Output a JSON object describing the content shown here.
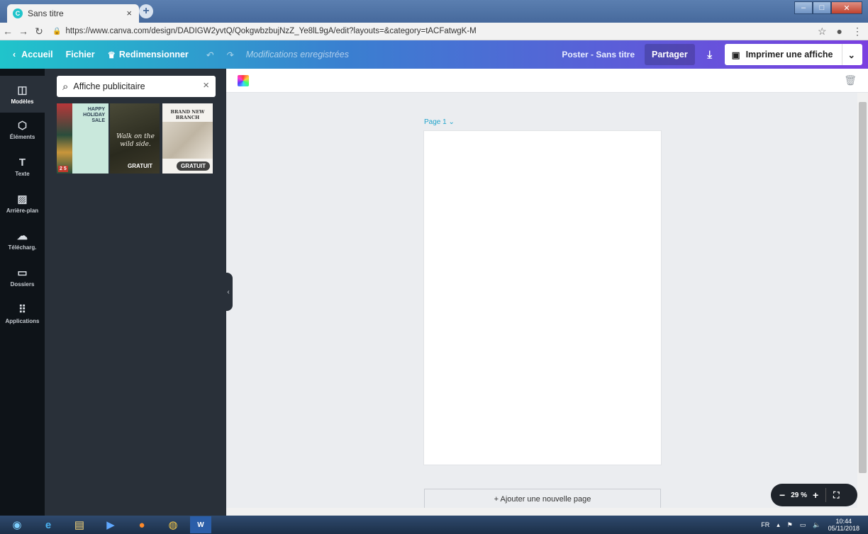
{
  "browser": {
    "tab_title": "Sans titre",
    "tab_favicon": "C",
    "url": "https://www.canva.com/design/DADIGW2yvtQ/QokgwbzbujNzZ_Ye8lL9gA/edit?layouts=&category=tACFatwgK-M"
  },
  "header": {
    "home": "Accueil",
    "file": "Fichier",
    "resize": "Redimensionner",
    "saved_status": "Modifications enregistrées",
    "design_title": "Poster - Sans titre",
    "share": "Partager",
    "print": "Imprimer une affiche"
  },
  "rail": {
    "items": [
      {
        "label": "Modèles",
        "icon": "templates-icon"
      },
      {
        "label": "Éléments",
        "icon": "elements-icon"
      },
      {
        "label": "Texte",
        "icon": "text-icon"
      },
      {
        "label": "Arrière-plan",
        "icon": "background-icon"
      },
      {
        "label": "Télécharg.",
        "icon": "upload-icon"
      },
      {
        "label": "Dossiers",
        "icon": "folder-icon"
      },
      {
        "label": "Applications",
        "icon": "apps-icon"
      }
    ]
  },
  "panel": {
    "search_value": "Affiche publicitaire",
    "templates": [
      {
        "title": "HAPPY HOLIDAY SALE",
        "badge": "",
        "digits": "2 5"
      },
      {
        "title": "Walk on the wild side.",
        "badge": "GRATUIT"
      },
      {
        "title": "BRAND NEW BRANCH",
        "badge": "GRATUIT"
      }
    ]
  },
  "editor": {
    "page_label": "Page 1 ⌄",
    "add_page": "+ Ajouter une nouvelle page",
    "zoom": "29 %"
  },
  "taskbar": {
    "lang": "FR",
    "time": "10:44",
    "date": "05/11/2018"
  },
  "colors": {
    "accent": "#20c4cb",
    "header_end": "#7a3fe0",
    "rail_bg": "#0e1318",
    "panel_bg": "#293039",
    "canvas_bg": "#ebedf0"
  }
}
